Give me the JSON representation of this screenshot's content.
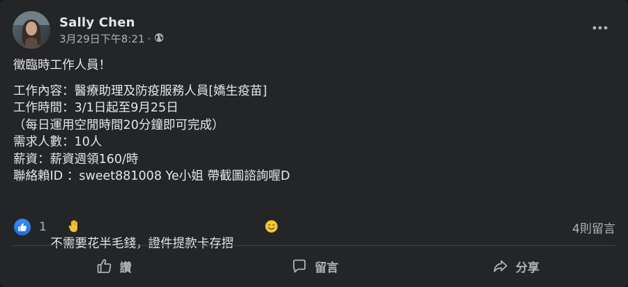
{
  "post": {
    "author": "Sally Chen",
    "timestamp": "3月29日下午8:21",
    "separator": "·",
    "audience_icon": "globe-icon",
    "title_line": "徵臨時工作人員！",
    "lines": [
      "工作內容：醫療助理及防疫服務人員[嬌生疫苗]",
      "工作時間：3/1日起至9月25日",
      "（每日運用空閒時間20分鐘即可完成）",
      "需求人數：10人",
      "薪資：薪資週領160/時",
      "聯絡賴ID ：sweet881008 Ye小姐 帶截圖諮詢喔D"
    ],
    "last_line_leading_emoji": "raised-hand-emoji",
    "last_line": "不需要花半毛錢，證件提款卡存摺",
    "last_line_trailing_emoji": "smiling-face-emoji"
  },
  "stats": {
    "reaction_icon": "like-icon",
    "reaction_count": "1",
    "comments_count": "4則留言"
  },
  "actions": {
    "like_label": "讚",
    "comment_label": "留言",
    "share_label": "分享"
  },
  "colors": {
    "background": "#242526",
    "text_primary": "#e4e6eb",
    "text_secondary": "#b0b3b8",
    "like_blue": "#1b74e4",
    "divider": "#3e4042"
  }
}
